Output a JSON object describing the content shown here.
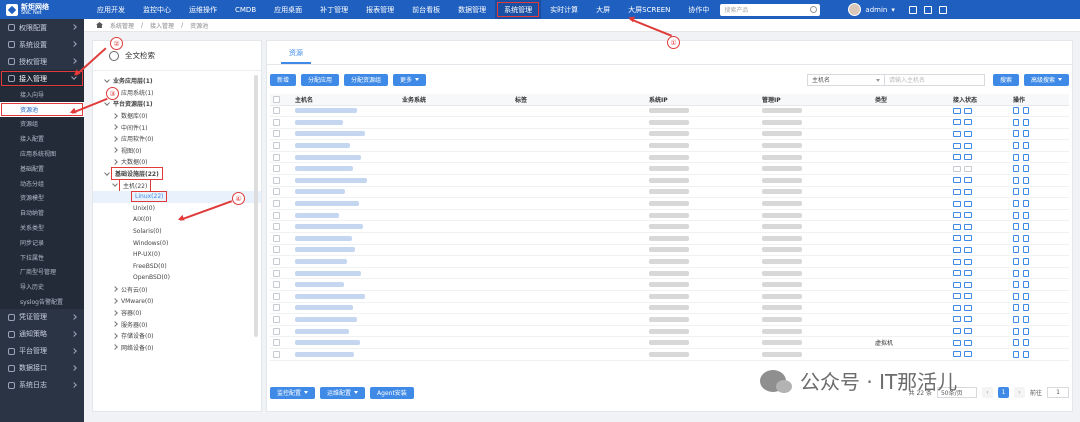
{
  "app": {
    "brand_name": "新炬网络",
    "brand_sub": "SNC Net"
  },
  "nav": [
    {
      "label": "应用开发"
    },
    {
      "label": "监控中心"
    },
    {
      "label": "运维操作"
    },
    {
      "label": "CMDB"
    },
    {
      "label": "应用桌面"
    },
    {
      "label": "补丁管理"
    },
    {
      "label": "报表管理"
    },
    {
      "label": "前台看板"
    },
    {
      "label": "数据管理"
    },
    {
      "label": "系统管理"
    },
    {
      "label": "实时计算"
    },
    {
      "label": "大屏"
    },
    {
      "label": "大屏SCREEN"
    },
    {
      "label": "协作中"
    }
  ],
  "search": {
    "placeholder": "搜索产品"
  },
  "user": {
    "name": "admin"
  },
  "sidebar": {
    "items": [
      {
        "label": "权限配置"
      },
      {
        "label": "系统设置"
      },
      {
        "label": "授权管理"
      },
      {
        "label": "接入管理"
      }
    ],
    "sub_items": [
      {
        "label": "接入向导"
      },
      {
        "label": "资源池"
      },
      {
        "label": "资源组"
      },
      {
        "label": "接入配置"
      },
      {
        "label": "应用系统视图"
      },
      {
        "label": "基础配置"
      },
      {
        "label": "动态分组"
      },
      {
        "label": "资源模型"
      },
      {
        "label": "自动纳管"
      },
      {
        "label": "关系类型"
      },
      {
        "label": "同步记录"
      },
      {
        "label": "下拉属性"
      },
      {
        "label": "厂商型号管理"
      },
      {
        "label": "导入历史"
      },
      {
        "label": "syslog告警配置"
      }
    ],
    "bottom_items": [
      {
        "label": "凭证管理"
      },
      {
        "label": "通知策略"
      },
      {
        "label": "平台管理"
      },
      {
        "label": "数据接口"
      },
      {
        "label": "系统日志"
      }
    ]
  },
  "breadcrumb": [
    "系统管理",
    "接入管理",
    "资源池"
  ],
  "tree": {
    "title": "全文检索",
    "nodes": [
      {
        "label": "业务应用层(1)",
        "level": 0
      },
      {
        "label": "应用系统(1)",
        "level": 1
      },
      {
        "label": "平台资源层(1)",
        "level": 0
      },
      {
        "label": "数据库(0)",
        "level": 1
      },
      {
        "label": "中间件(1)",
        "level": 1
      },
      {
        "label": "应用软件(0)",
        "level": 1
      },
      {
        "label": "视图(0)",
        "level": 1
      },
      {
        "label": "大数据(0)",
        "level": 1
      },
      {
        "label": "基础设施层(22)",
        "level": 0
      },
      {
        "label": "主机(22)",
        "level": 1
      },
      {
        "label": "Linux(22)",
        "level": 2
      },
      {
        "label": "Unix(0)",
        "level": 2
      },
      {
        "label": "AIX(0)",
        "level": 2
      },
      {
        "label": "Solaris(0)",
        "level": 2
      },
      {
        "label": "Windows(0)",
        "level": 2
      },
      {
        "label": "HP-UX(0)",
        "level": 2
      },
      {
        "label": "FreeBSD(0)",
        "level": 2
      },
      {
        "label": "OpenBSD(0)",
        "level": 2
      },
      {
        "label": "公有云(0)",
        "level": 1
      },
      {
        "label": "VMware(0)",
        "level": 1
      },
      {
        "label": "容器(0)",
        "level": 1
      },
      {
        "label": "服务器(0)",
        "level": 1
      },
      {
        "label": "存储设备(0)",
        "level": 1
      },
      {
        "label": "网络设备(0)",
        "level": 1
      }
    ]
  },
  "main": {
    "tab": "资源",
    "buttons": {
      "add": "新增",
      "assign_app": "分配应用",
      "assign_group": "分配资源组",
      "more": "更多"
    },
    "filter_field": "主机名",
    "filter_placeholder": "请输入主机名",
    "search_btn": "搜索",
    "advanced_btn": "高级搜索",
    "columns": [
      "主机名",
      "业务系统",
      "标签",
      "系统IP",
      "管理IP",
      "类型",
      "接入状态",
      "操作"
    ],
    "type_value_row": "虚拟机",
    "footer_buttons": {
      "monitor": "监控配置",
      "ops": "运维配置",
      "agent": "Agent安装"
    },
    "pager": {
      "total": "共 22 条",
      "page_size": "50条/页",
      "current": "1",
      "goto_label": "前往",
      "goto_value": "1"
    }
  },
  "annotations": [
    "①",
    "②",
    "③",
    "④"
  ],
  "watermark": "公众号 · IT那活儿",
  "colors": {
    "topbar": "#1f5fbf",
    "sidebar": "#2b3445",
    "accent": "#3f8ae6",
    "annotation": "#e03a3a"
  }
}
